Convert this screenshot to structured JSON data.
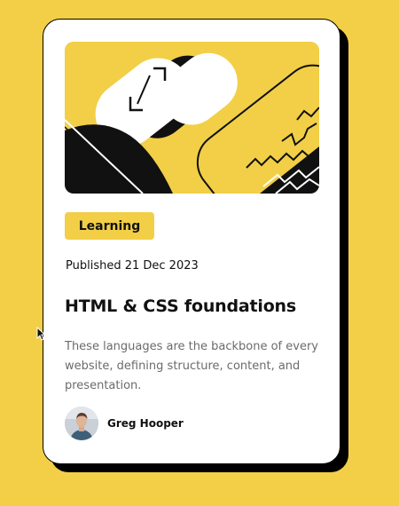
{
  "card": {
    "tag_label": "Learning",
    "published": "Published 21 Dec 2023",
    "title": "HTML & CSS foundations",
    "description": "These languages are the backbone of every website, defining structure, content, and presentation.",
    "author": {
      "name": "Greg Hooper",
      "avatar_icon": "person-avatar"
    },
    "hero_icon": "abstract-illustration"
  },
  "colors": {
    "background": "#f2cf46",
    "accent": "#f2cf46",
    "card": "#ffffff",
    "text": "#111111",
    "muted_text": "#6b6b6b",
    "shadow": "#000000"
  }
}
